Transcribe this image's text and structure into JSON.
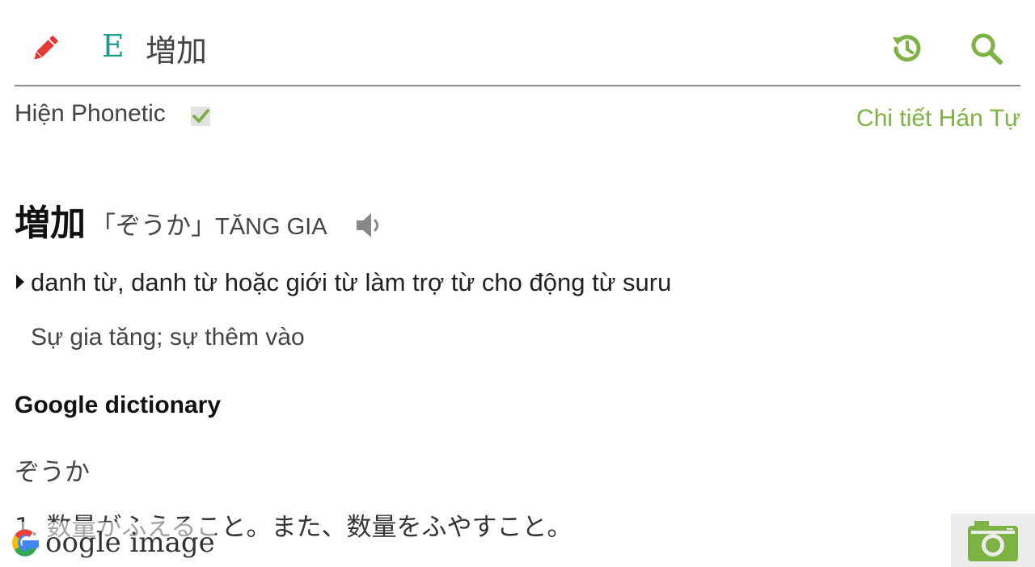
{
  "header": {
    "language_indicator": "E",
    "search_value": "増加",
    "icons": {
      "edit": "pencil-icon",
      "history": "history-icon",
      "search": "search-icon"
    },
    "colors": {
      "accent": "#7cb342",
      "pencil": "#e53935",
      "language": "#1a9c8c"
    }
  },
  "options": {
    "phonetic_label": "Hiện Phonetic",
    "phonetic_checked": true,
    "detail_link": "Chi tiết Hán Tự"
  },
  "entry": {
    "word": "増加",
    "reading": "「ぞうか」",
    "han_viet": "TĂNG GIA",
    "part_of_speech": "danh từ, danh từ hoặc giới từ làm trợ từ cho động từ suru",
    "meaning": "Sự gia tăng; sự thêm vào"
  },
  "google_dictionary": {
    "title": "Google dictionary",
    "reading": "ぞうか",
    "definition": "1. 数量がふえること。また、数量をふやすこと。"
  },
  "overlay": {
    "google_image_label": "oogle image",
    "camera_icon": "camera-icon"
  }
}
